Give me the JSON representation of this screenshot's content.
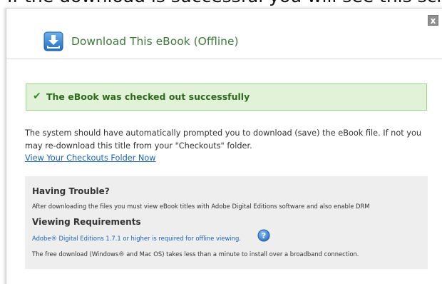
{
  "caption": {
    "text": "If the download is successful you will see this screen"
  },
  "dialog": {
    "close_label": "x",
    "title": "Download This eBook (Offline)",
    "icons": {
      "download": "download-arrow-icon",
      "check": "checkmark-icon",
      "help": "question-mark-help-icon",
      "close": "close-icon"
    }
  },
  "success": {
    "check_glyph": "✔",
    "message": "The eBook was checked out successfully"
  },
  "info": {
    "line1": "The system should have automatically prompted you to download (save) the eBook file. If not you",
    "line2": "may re-download this title from your \"Checkouts\" folder.",
    "link": "View Your Checkouts Folder Now"
  },
  "help": {
    "trouble_heading": "Having Trouble?",
    "trouble_text": "After downloading the files you must view eBook titles with Adobe Digital Editions software and also enable DRM",
    "requirements_heading": "Viewing Requirements",
    "requirements_link": "Adobe® Digital Editions 1.7.1 or higher is required for offline viewing.",
    "install_text": "The free download (Windows® and Mac OS) takes less than a minute to install over a broadband connection."
  },
  "colors": {
    "title_green": "#3d7a3b",
    "success_bg": "#e2f2d8",
    "success_border": "#9fd28c",
    "success_text": "#2e6a1b",
    "link_blue": "#1a63b8",
    "help_bg": "#eeeeee",
    "icon_blue": "#2f7fcf"
  }
}
